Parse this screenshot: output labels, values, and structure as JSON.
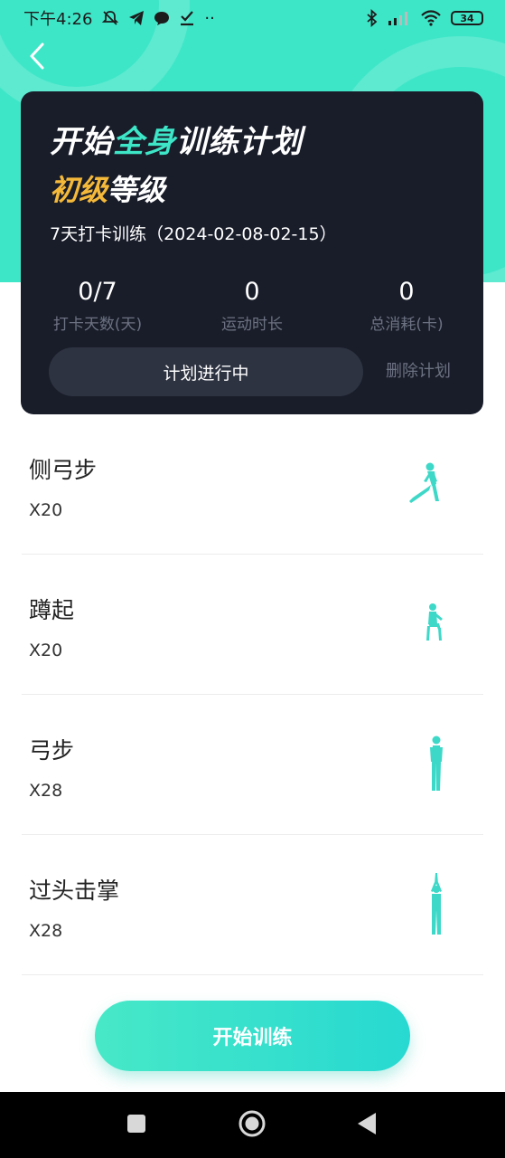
{
  "status_bar": {
    "time": "下午4:26",
    "battery": "34",
    "dots": "··",
    "left_icons": [
      "mute-icon",
      "telegram-icon",
      "chat-bubble-icon",
      "download-check-icon"
    ],
    "right_icons": [
      "bluetooth-icon",
      "signal-icon",
      "wifi-icon",
      "battery-icon"
    ]
  },
  "colors": {
    "accent": "#3ee6c8",
    "level": "#f5b93a",
    "card_bg": "#191d2a",
    "muted": "#6d7282"
  },
  "plan": {
    "title_prefix": "开始",
    "title_highlight": "全身",
    "title_suffix": "训练计划",
    "level_highlight": "初级",
    "level_suffix": "等级",
    "subtitle": "7天打卡训练（2024-02-08-02-15）",
    "stats": [
      {
        "value": "0/7",
        "label": "打卡天数(天)"
      },
      {
        "value": "0",
        "label": "运动时长"
      },
      {
        "value": "0",
        "label": "总消耗(卡)"
      }
    ],
    "status_button": "计划进行中",
    "delete_button": "删除计划"
  },
  "exercises": [
    {
      "name": "侧弓步",
      "reps": "X20",
      "icon": "side-lunge-figure-icon"
    },
    {
      "name": "蹲起",
      "reps": "X20",
      "icon": "squat-figure-icon"
    },
    {
      "name": "弓步",
      "reps": "X28",
      "icon": "lunge-figure-icon"
    },
    {
      "name": "过头击掌",
      "reps": "X28",
      "icon": "overhead-clap-figure-icon"
    }
  ],
  "start_button": "开始训练"
}
